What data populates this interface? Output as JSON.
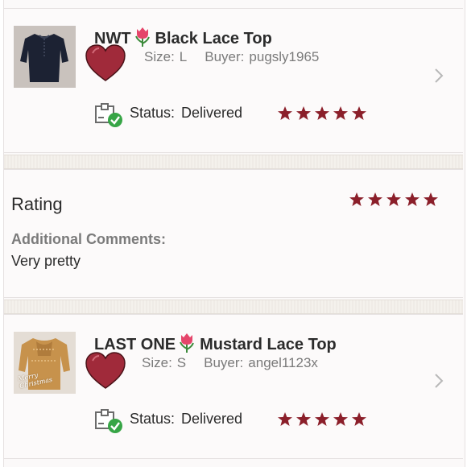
{
  "colors": {
    "star": "#8b1f2a",
    "heart": "#a02a3a",
    "delivered_check": "#37a546",
    "muted_text": "#7a7a7a"
  },
  "orders": [
    {
      "title_prefix": "NWT",
      "title_emoji": "tulip",
      "title": "Black Lace Top",
      "size_label": "Size:",
      "size_value": "L",
      "buyer_label": "Buyer:",
      "buyer_value": "pugsly1965",
      "status_label": "Status:",
      "status_value": "Delivered",
      "stars": 5,
      "icons": {
        "like": "heart-icon",
        "status": "package-delivered-icon",
        "next": "chevron-right-icon"
      }
    },
    {
      "title_prefix": "LAST ONE",
      "title_emoji": "tulip",
      "title": "Mustard Lace Top",
      "size_label": "Size:",
      "size_value": "S",
      "buyer_label": "Buyer:",
      "buyer_value": "angel1123x",
      "status_label": "Status:",
      "status_value": "Delivered",
      "stars": 5,
      "thumb_text": "Merry Christmas",
      "icons": {
        "like": "heart-icon",
        "status": "package-delivered-icon",
        "next": "chevron-right-icon"
      }
    }
  ],
  "rating": {
    "label": "Rating",
    "stars": 5,
    "comments_label": "Additional Comments:",
    "comments_text": "Very pretty"
  }
}
